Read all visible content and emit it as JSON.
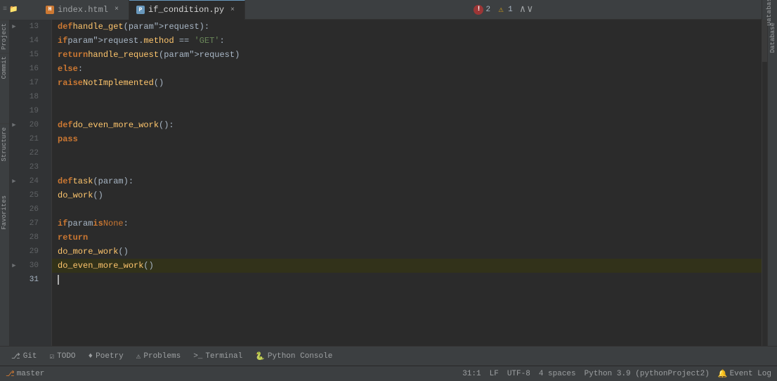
{
  "tabs": [
    {
      "name": "index.html",
      "type": "html",
      "active": false
    },
    {
      "name": "if_condition.py",
      "type": "py",
      "active": true
    }
  ],
  "errors": {
    "error_count": 2,
    "warning_count": 1
  },
  "lines": [
    {
      "num": 13,
      "fold": "▶",
      "content": "def handle_get(request):",
      "type": "def_line"
    },
    {
      "num": 14,
      "fold": "",
      "content": "    if request.method == 'GET':",
      "type": "if_line"
    },
    {
      "num": 15,
      "fold": "",
      "content": "        return handle_request(request)",
      "type": "return_line"
    },
    {
      "num": 16,
      "fold": "",
      "content": "    else:",
      "type": "else_line"
    },
    {
      "num": 17,
      "fold": "",
      "content": "        raise NotImplemented()",
      "type": "raise_line"
    },
    {
      "num": 18,
      "fold": "",
      "content": "",
      "type": "empty"
    },
    {
      "num": 19,
      "fold": "",
      "content": "",
      "type": "empty"
    },
    {
      "num": 20,
      "fold": "▶",
      "content": "def do_even_more_work():",
      "type": "def_line"
    },
    {
      "num": 21,
      "fold": "",
      "content": "    pass",
      "type": "pass_line"
    },
    {
      "num": 22,
      "fold": "",
      "content": "",
      "type": "empty"
    },
    {
      "num": 23,
      "fold": "",
      "content": "",
      "type": "empty"
    },
    {
      "num": 24,
      "fold": "▶",
      "content": "def task(param):",
      "type": "def_line"
    },
    {
      "num": 25,
      "fold": "",
      "content": "    do_work()",
      "type": "call_line"
    },
    {
      "num": 26,
      "fold": "",
      "content": "",
      "type": "empty"
    },
    {
      "num": 27,
      "fold": "",
      "content": "    if param is None:",
      "type": "if_line"
    },
    {
      "num": 28,
      "fold": "",
      "content": "        return",
      "type": "return_line"
    },
    {
      "num": 29,
      "fold": "",
      "content": "    do_more_work()",
      "type": "call_line"
    },
    {
      "num": 30,
      "fold": "▶",
      "content": "    do_even_more_work()",
      "type": "call_line"
    },
    {
      "num": 31,
      "fold": "",
      "content": "",
      "type": "cursor_line",
      "active": true
    }
  ],
  "bottom_tabs": [
    {
      "label": "Git",
      "icon": "git"
    },
    {
      "label": "TODO",
      "icon": "list"
    },
    {
      "label": "Poetry",
      "icon": "poetry"
    },
    {
      "label": "Problems",
      "icon": "problems"
    },
    {
      "label": "Terminal",
      "icon": "terminal"
    },
    {
      "label": "Python Console",
      "icon": "python"
    }
  ],
  "status_bar": {
    "position": "31:1",
    "line_ending": "LF",
    "encoding": "UTF-8",
    "indent": "4 spaces",
    "interpreter": "Python 3.9 (pythonProject2)",
    "branch": "master",
    "event_log": "Event Log"
  },
  "right_panel_label": "Database",
  "left_panel_labels": [
    "Project",
    "Commit",
    "Structure",
    "Favorites"
  ],
  "cursor_line": 31
}
